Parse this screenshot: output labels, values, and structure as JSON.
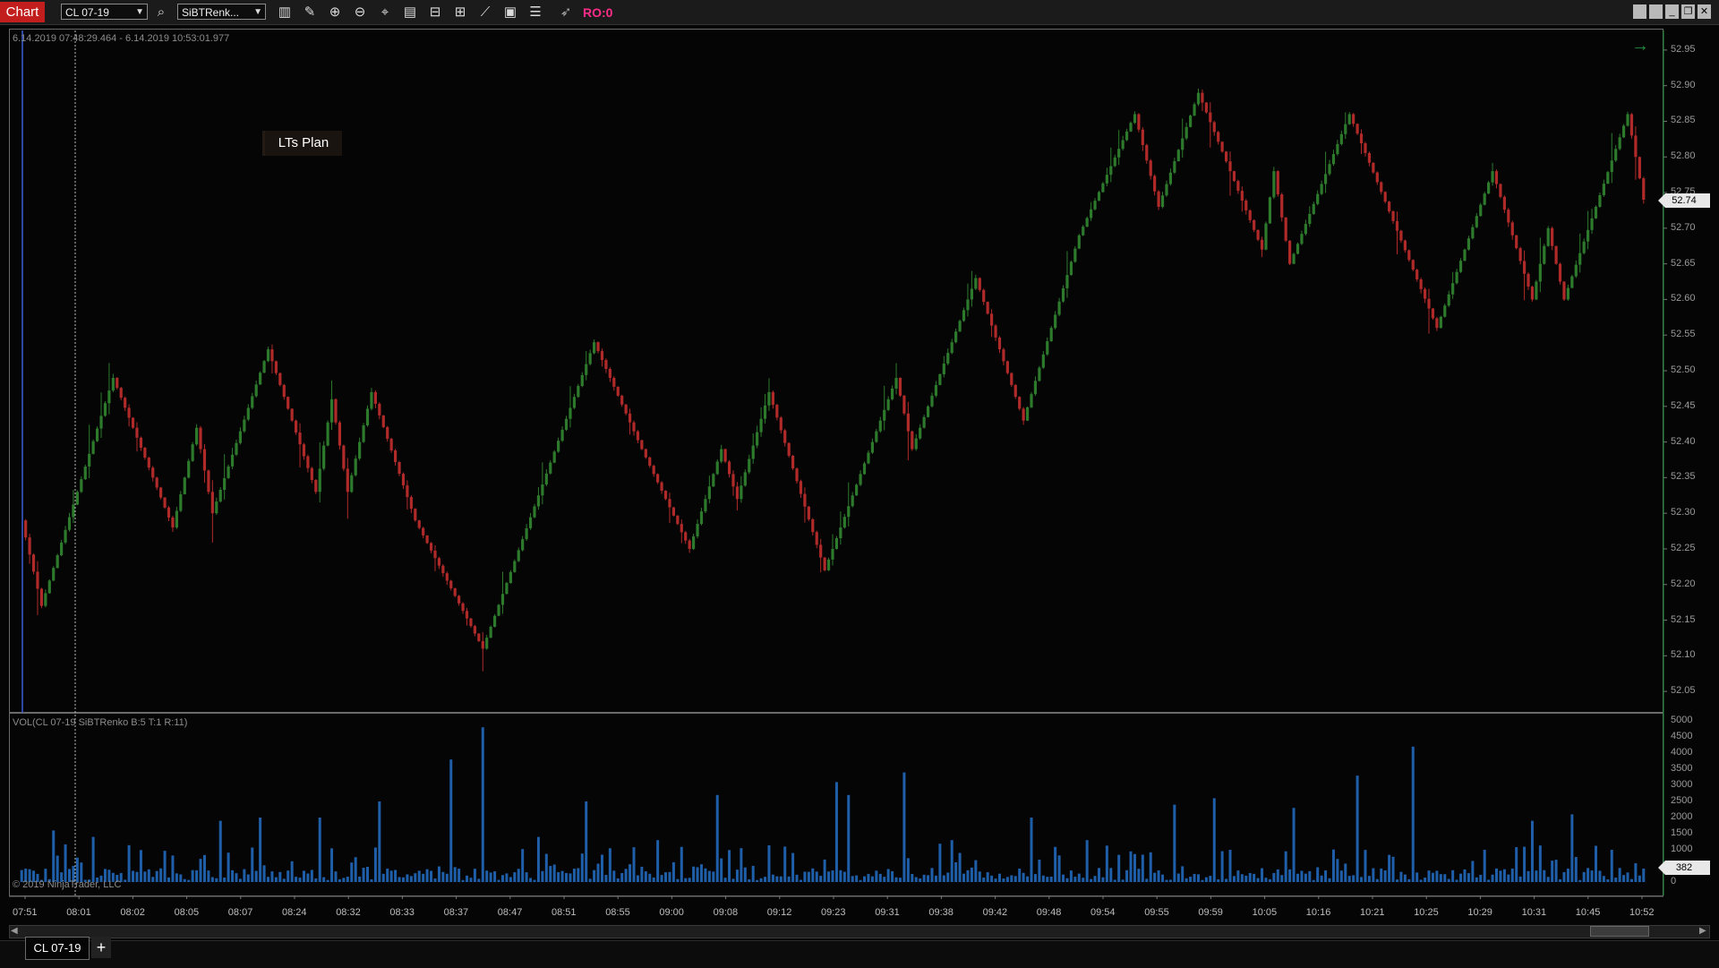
{
  "toolbar": {
    "chart_tab": "Chart",
    "instrument_select": "CL 07-19",
    "bar_type_select": "SiBTRenk...",
    "ro_label": "RO:0",
    "icons": [
      "search-icon",
      "bar-style-icon",
      "drawing-tools-icon",
      "zoom-in-icon",
      "zoom-out-icon",
      "crosshair-icon",
      "data-box-icon",
      "properties-icon",
      "indicators-icon",
      "strategies-icon",
      "templates-icon",
      "shark-icon"
    ]
  },
  "chart": {
    "range_text": "6.14.2019 07:48:29.464 - 6.14.2019 10:53:01.977",
    "annotation_text": "LTs Plan",
    "last_price_label": "52.74",
    "volume_indicator_label": "VOL(CL 07-19 SiBTRenko B:5 T:1 R:11)",
    "last_volume_label": "382",
    "copyright": "© 2019 NinjaTrader, LLC",
    "price_axis_labels": [
      "52.95",
      "52.90",
      "52.85",
      "52.80",
      "52.75",
      "52.70",
      "52.65",
      "52.60",
      "52.55",
      "52.50",
      "52.45",
      "52.40",
      "52.35",
      "52.30",
      "52.25",
      "52.20",
      "52.15",
      "52.10",
      "52.05"
    ],
    "volume_axis_labels": [
      "5000",
      "4500",
      "4000",
      "3500",
      "3000",
      "2500",
      "2000",
      "1500",
      "1000",
      "500",
      "0"
    ],
    "time_axis_labels": [
      "07:51",
      "08:01",
      "08:02",
      "08:05",
      "08:07",
      "08:24",
      "08:32",
      "08:33",
      "08:37",
      "08:47",
      "08:51",
      "08:55",
      "09:00",
      "09:08",
      "09:12",
      "09:23",
      "09:31",
      "09:38",
      "09:42",
      "09:48",
      "09:54",
      "09:55",
      "09:59",
      "10:05",
      "10:16",
      "10:21",
      "10:25",
      "10:29",
      "10:31",
      "10:45",
      "10:52"
    ],
    "colors": {
      "up": "#2d7a2d",
      "down": "#b02a2a",
      "volume": "#1f5faa",
      "crosshair": "#bbbbbb",
      "start_line": "#3a5ed8"
    }
  },
  "chart_data": {
    "type": "candlestick",
    "instrument": "CL 07-19",
    "price_pivots": [
      {
        "i": 0,
        "p": 52.29
      },
      {
        "i": 5,
        "p": 52.17
      },
      {
        "i": 23,
        "p": 52.49
      },
      {
        "i": 38,
        "p": 52.28
      },
      {
        "i": 44,
        "p": 52.42
      },
      {
        "i": 48,
        "p": 52.3
      },
      {
        "i": 62,
        "p": 52.53
      },
      {
        "i": 74,
        "p": 52.33
      },
      {
        "i": 78,
        "p": 52.46
      },
      {
        "i": 82,
        "p": 52.33
      },
      {
        "i": 88,
        "p": 52.47
      },
      {
        "i": 99,
        "p": 52.29
      },
      {
        "i": 116,
        "p": 52.11
      },
      {
        "i": 144,
        "p": 52.54
      },
      {
        "i": 156,
        "p": 52.39
      },
      {
        "i": 168,
        "p": 52.25
      },
      {
        "i": 176,
        "p": 52.39
      },
      {
        "i": 180,
        "p": 52.32
      },
      {
        "i": 188,
        "p": 52.47
      },
      {
        "i": 202,
        "p": 52.22
      },
      {
        "i": 220,
        "p": 52.49
      },
      {
        "i": 224,
        "p": 52.39
      },
      {
        "i": 240,
        "p": 52.63
      },
      {
        "i": 252,
        "p": 52.43
      },
      {
        "i": 266,
        "p": 52.69
      },
      {
        "i": 280,
        "p": 52.86
      },
      {
        "i": 286,
        "p": 52.73
      },
      {
        "i": 296,
        "p": 52.89
      },
      {
        "i": 312,
        "p": 52.67
      },
      {
        "i": 315,
        "p": 52.78
      },
      {
        "i": 319,
        "p": 52.65
      },
      {
        "i": 334,
        "p": 52.86
      },
      {
        "i": 356,
        "p": 52.56
      },
      {
        "i": 370,
        "p": 52.78
      },
      {
        "i": 380,
        "p": 52.6
      },
      {
        "i": 384,
        "p": 52.7
      },
      {
        "i": 388,
        "p": 52.6
      },
      {
        "i": 404,
        "p": 52.86
      },
      {
        "i": 408,
        "p": 52.74
      }
    ],
    "volume_peaks": [
      {
        "i": 8,
        "v": 1600
      },
      {
        "i": 18,
        "v": 1400
      },
      {
        "i": 50,
        "v": 1900
      },
      {
        "i": 60,
        "v": 2000
      },
      {
        "i": 75,
        "v": 2000
      },
      {
        "i": 90,
        "v": 2500
      },
      {
        "i": 108,
        "v": 3800
      },
      {
        "i": 116,
        "v": 4800
      },
      {
        "i": 130,
        "v": 1400
      },
      {
        "i": 142,
        "v": 2500
      },
      {
        "i": 160,
        "v": 1300
      },
      {
        "i": 175,
        "v": 2700
      },
      {
        "i": 192,
        "v": 1100
      },
      {
        "i": 205,
        "v": 3100
      },
      {
        "i": 208,
        "v": 2700
      },
      {
        "i": 222,
        "v": 3400
      },
      {
        "i": 234,
        "v": 1300
      },
      {
        "i": 254,
        "v": 2000
      },
      {
        "i": 268,
        "v": 1300
      },
      {
        "i": 290,
        "v": 2400
      },
      {
        "i": 300,
        "v": 2600
      },
      {
        "i": 320,
        "v": 2300
      },
      {
        "i": 336,
        "v": 3300
      },
      {
        "i": 350,
        "v": 4200
      },
      {
        "i": 368,
        "v": 1000
      },
      {
        "i": 380,
        "v": 1900
      },
      {
        "i": 390,
        "v": 2100
      },
      {
        "i": 400,
        "v": 1000
      }
    ],
    "y_range": [
      52.02,
      52.98
    ],
    "volume_range": [
      0,
      5000
    ]
  }
}
